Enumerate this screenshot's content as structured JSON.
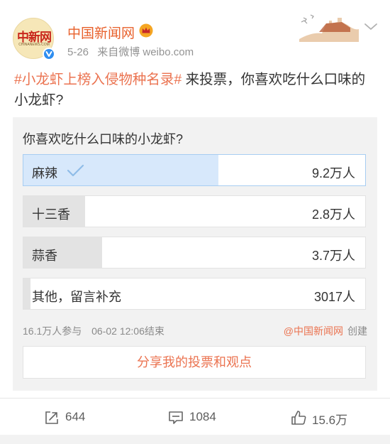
{
  "header": {
    "username": "中国新闻网",
    "avatar_text": "中新网",
    "avatar_subtext": "CHINANEWS.COM",
    "post_date": "5-26",
    "post_source": "来自微博 weibo.com"
  },
  "post": {
    "hashtag": "#小龙虾上榜入侵物种名录#",
    "text": " 来投票，你喜欢吃什么口味的小龙虾?"
  },
  "poll": {
    "question": "你喜欢吃什么口味的小龙虾?",
    "options": [
      {
        "label": "麻辣",
        "count": "9.2万人",
        "selected": true,
        "share": 0.57
      },
      {
        "label": "十三香",
        "count": "2.8万人",
        "selected": false,
        "share": 0.18
      },
      {
        "label": "蒜香",
        "count": "3.7万人",
        "selected": false,
        "share": 0.23
      },
      {
        "label": "其他，留言补充",
        "count": "3017人",
        "selected": false,
        "share": 0.02
      }
    ],
    "participants": "16.1万人参与",
    "end_time": "06-02 12:06结束",
    "creator": "@中国新闻网",
    "creator_suffix": "创建",
    "share_label": "分享我的投票和观点"
  },
  "actions": {
    "repost_count": "644",
    "comment_count": "1084",
    "like_count": "15.6万"
  },
  "icons": [
    "verified-icon",
    "crown-badge-icon",
    "great-wall-banner-icon",
    "chevron-down-icon",
    "checkmark-icon",
    "repost-icon",
    "comment-icon",
    "like-icon"
  ],
  "colors": {
    "accent": "#eb7350",
    "username": "#e8612c",
    "selected_fill": "#d7e8fb",
    "option_fill": "#e3e3e3",
    "verified": "#2f8ef0"
  }
}
